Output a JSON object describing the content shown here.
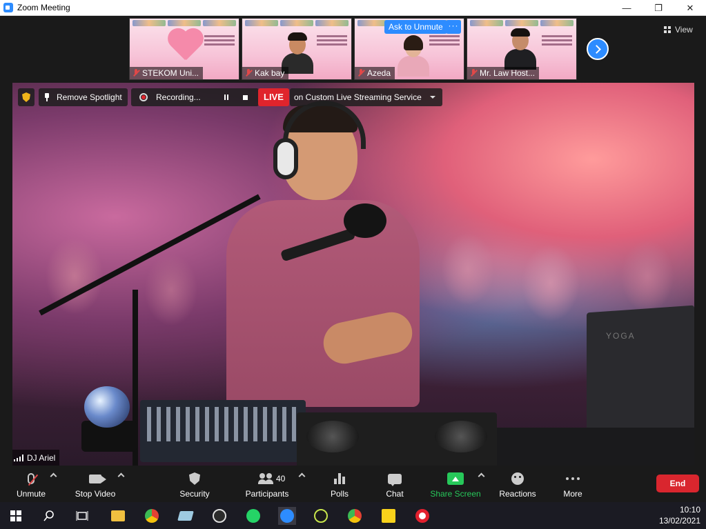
{
  "window": {
    "title": "Zoom Meeting",
    "controls": [
      "—",
      "❐",
      "✕"
    ]
  },
  "view": {
    "label": "View"
  },
  "thumbnails": [
    {
      "name": "STEKOM Uni...",
      "muted": true
    },
    {
      "name": "Kak bay",
      "muted": true
    },
    {
      "name": "Azeda",
      "muted": true,
      "ask_unmute": "Ask to Unmute",
      "more": "···"
    },
    {
      "name": "Mr. Law Host...",
      "muted": true
    }
  ],
  "main_video": {
    "remove_spotlight": "Remove Spotlight",
    "recording": "Recording...",
    "live": "LIVE",
    "stream_service": "on Custom Live Streaming Service",
    "speaker_name": "DJ Ariel",
    "laptop_brand": "YOGA"
  },
  "toolbar": {
    "unmute": "Unmute",
    "stop_video": "Stop Video",
    "security": "Security",
    "participants": "Participants",
    "participants_count": "40",
    "polls": "Polls",
    "chat": "Chat",
    "share_screen": "Share Screen",
    "reactions": "Reactions",
    "more": "More",
    "end": "End"
  },
  "taskbar": {
    "time": "10:10",
    "date": "13/02/2021"
  },
  "colors": {
    "accent": "#2d8cff",
    "live": "#e0242c",
    "end": "#d9262e",
    "share": "#27c85a"
  }
}
